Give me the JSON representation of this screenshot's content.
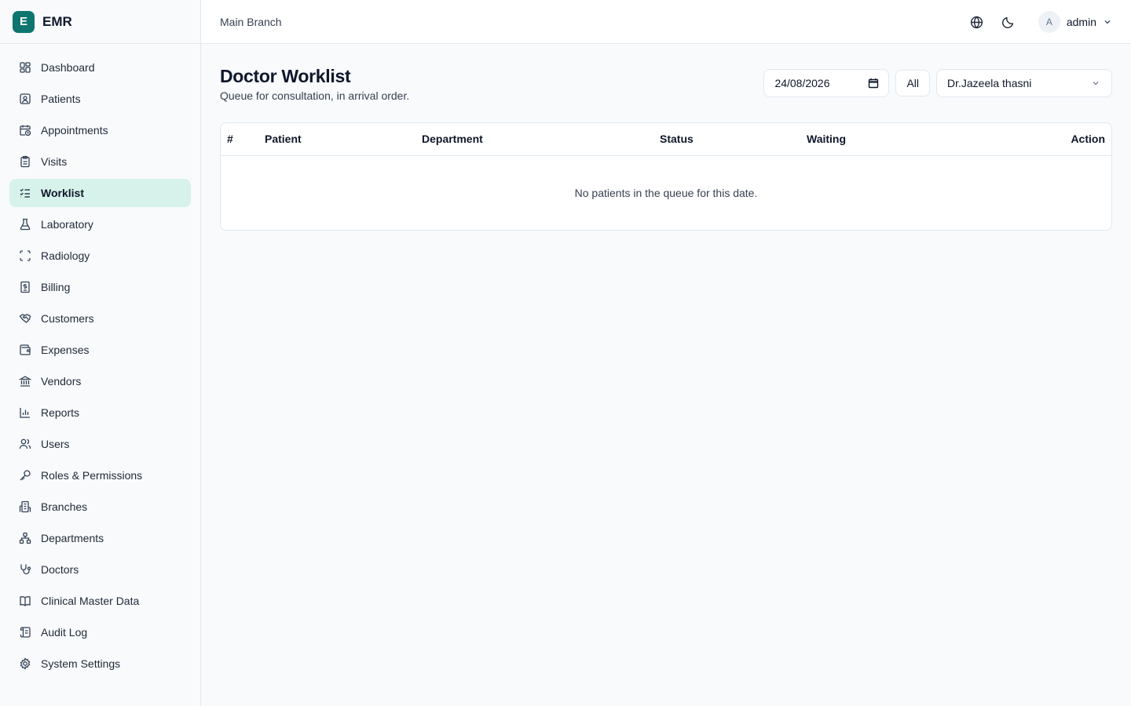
{
  "brand": {
    "logo_letter": "E",
    "name": "EMR",
    "color": "#0f766e"
  },
  "sidebar": {
    "items": [
      {
        "label": "Dashboard",
        "icon": "dashboard-icon"
      },
      {
        "label": "Patients",
        "icon": "patients-icon"
      },
      {
        "label": "Appointments",
        "icon": "calendar-clock-icon"
      },
      {
        "label": "Visits",
        "icon": "clipboard-icon"
      },
      {
        "label": "Worklist",
        "icon": "list-checks-icon",
        "active": true
      },
      {
        "label": "Laboratory",
        "icon": "flask-icon"
      },
      {
        "label": "Radiology",
        "icon": "scan-icon"
      },
      {
        "label": "Billing",
        "icon": "receipt-icon"
      },
      {
        "label": "Customers",
        "icon": "handshake-icon"
      },
      {
        "label": "Expenses",
        "icon": "wallet-icon"
      },
      {
        "label": "Vendors",
        "icon": "bank-icon"
      },
      {
        "label": "Reports",
        "icon": "bar-chart-icon"
      },
      {
        "label": "Users",
        "icon": "users-icon"
      },
      {
        "label": "Roles & Permissions",
        "icon": "key-icon"
      },
      {
        "label": "Branches",
        "icon": "building-icon"
      },
      {
        "label": "Departments",
        "icon": "network-icon"
      },
      {
        "label": "Doctors",
        "icon": "stethoscope-icon"
      },
      {
        "label": "Clinical Master Data",
        "icon": "book-icon"
      },
      {
        "label": "Audit Log",
        "icon": "scroll-icon"
      },
      {
        "label": "System Settings",
        "icon": "gear-icon"
      }
    ]
  },
  "topbar": {
    "branch": "Main Branch",
    "user": {
      "avatar_letter": "A",
      "name": "admin"
    }
  },
  "main": {
    "title": "Doctor Worklist",
    "subtitle": "Queue for consultation, in arrival order.",
    "date_value": "24/08/2026",
    "all_button": "All",
    "doctor_select": "Dr.Jazeela thasni",
    "table": {
      "columns": [
        "#",
        "Patient",
        "Department",
        "Status",
        "Waiting",
        "Action"
      ],
      "empty_message": "No patients in the queue for this date."
    }
  },
  "colors": {
    "active_nav_bg": "#d7f2ea",
    "page_bg": "#f8fafc",
    "border": "#e2e8f0"
  }
}
